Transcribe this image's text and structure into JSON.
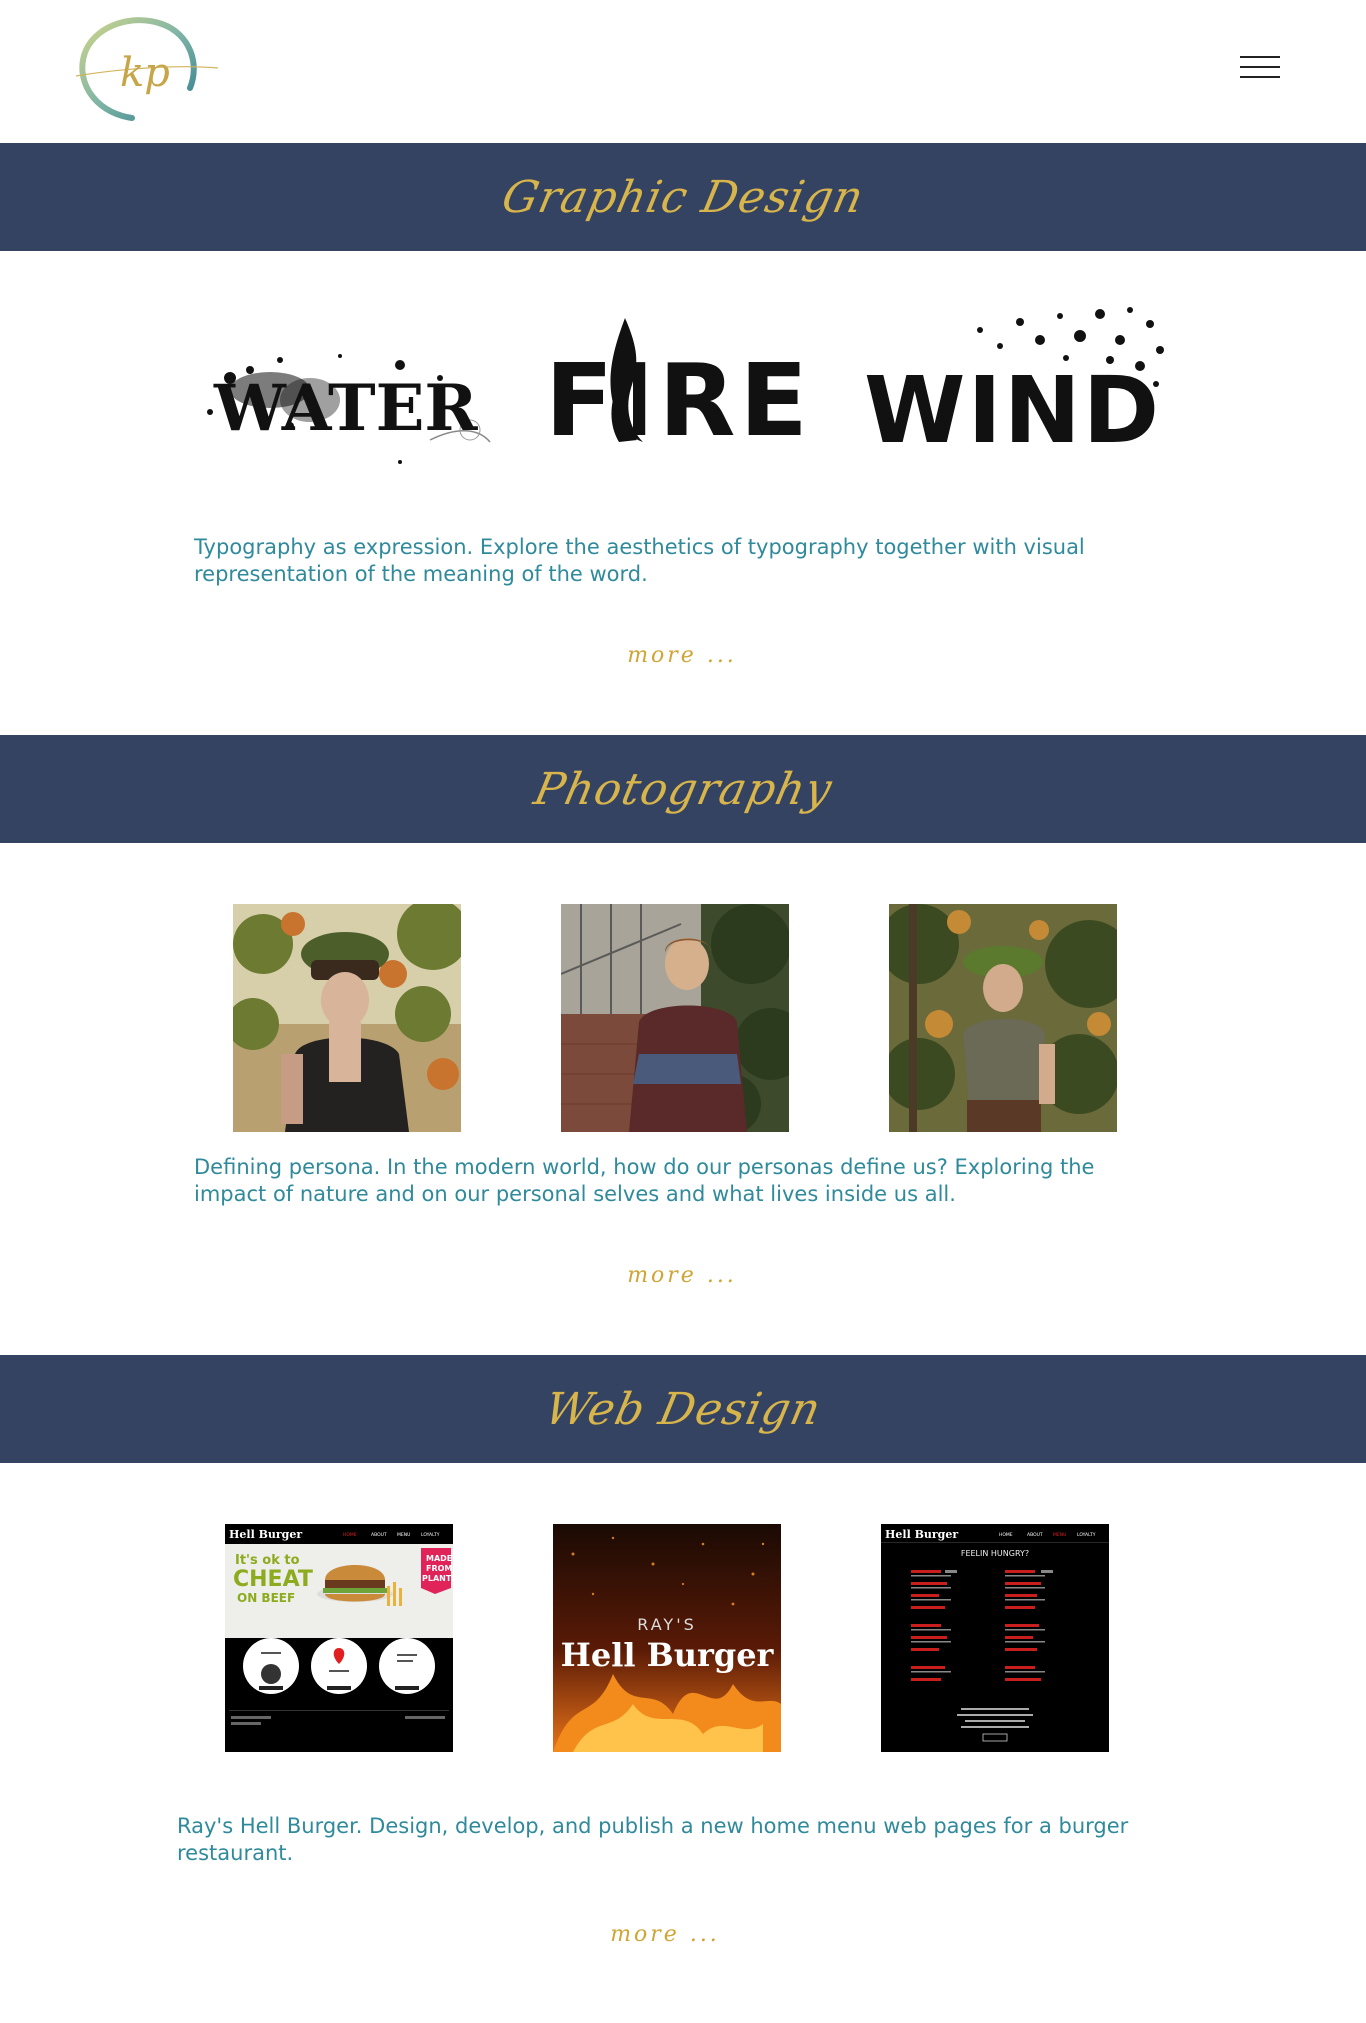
{
  "logo": {
    "monogram": "kp"
  },
  "sections": {
    "graphic": {
      "title": "Graphic Design",
      "words": [
        "WATER",
        "FIRE",
        "WIND"
      ],
      "description": "Typography as expression.  Explore the aesthetics of typography together with visual representation of the meaning of the word.",
      "more": "more ..."
    },
    "photo": {
      "title": "Photography",
      "description": "Defining persona.  In the modern world, how do our personas define us?  Exploring the impact of nature and on our personal selves and what lives inside us all.",
      "more": "more ..."
    },
    "web": {
      "title": "Web Design",
      "description": "Ray's Hell Burger.  Design, develop, and publish a new home menu web pages for a burger restaurant.",
      "more": "more ...",
      "home": {
        "brand": "Hell Burger",
        "nav": [
          "HOME",
          "ABOUT",
          "MENU",
          "LOYALTY"
        ],
        "line1": "It's ok to",
        "line2": "CHEAT",
        "line3": "ON BEEF",
        "badge1": "MADE",
        "badge2": "FROM",
        "badge3": "PLANTS"
      },
      "logo_card": {
        "top": "RAY'S",
        "bottom": "Hell Burger"
      },
      "menu_page": {
        "brand": "Hell Burger",
        "nav": [
          "HOME",
          "ABOUT",
          "MENU",
          "LOYALTY"
        ],
        "heading": "FEELIN HUNGRY?"
      }
    }
  },
  "colors": {
    "banner": "#344362",
    "gold": "#d8b54b",
    "teal": "#2f8a9b"
  }
}
